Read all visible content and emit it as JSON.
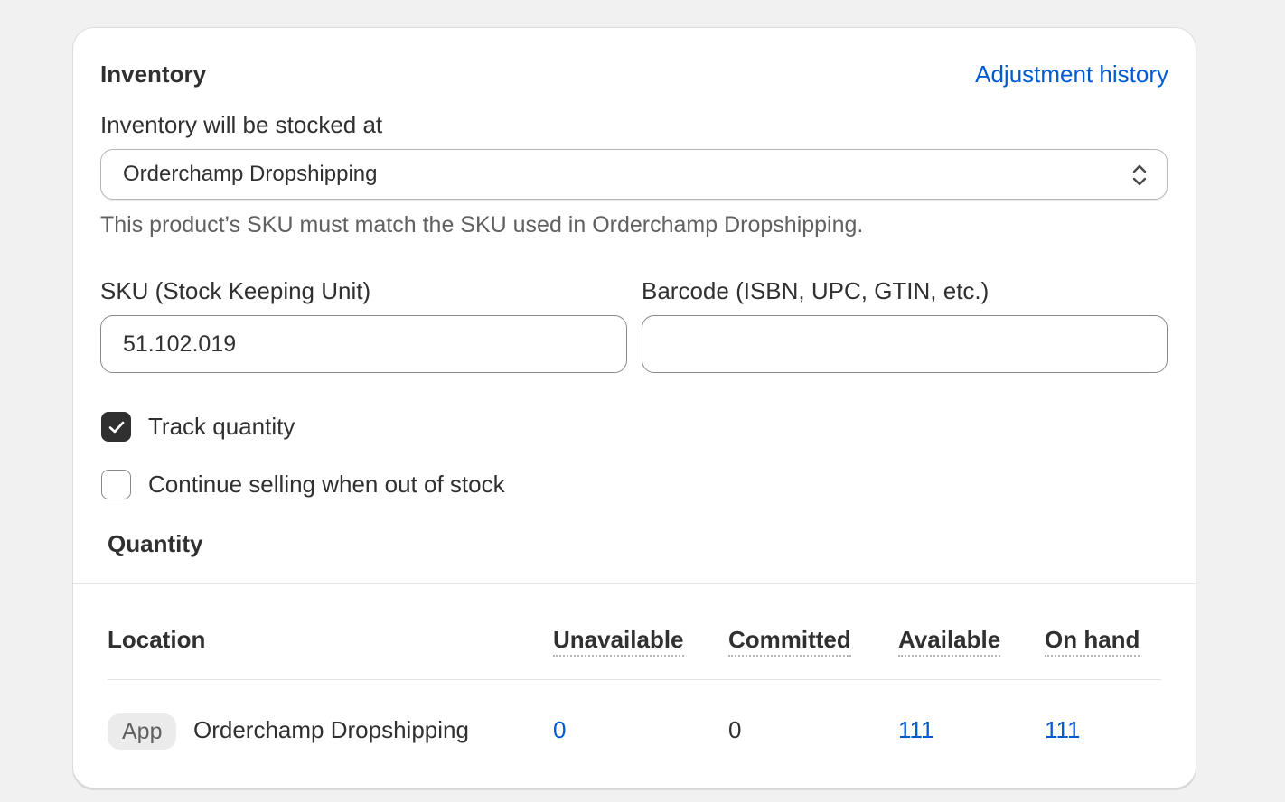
{
  "card": {
    "title": "Inventory",
    "history_link": "Adjustment history"
  },
  "stock_location": {
    "label": "Inventory will be stocked at",
    "selected": "Orderchamp Dropshipping",
    "help_text": "This product’s SKU must match the SKU used in Orderchamp Dropshipping."
  },
  "fields": {
    "sku": {
      "label": "SKU (Stock Keeping Unit)",
      "value": "51.102.019"
    },
    "barcode": {
      "label": "Barcode (ISBN, UPC, GTIN, etc.)",
      "value": ""
    }
  },
  "checkboxes": {
    "track_quantity": {
      "label": "Track quantity",
      "checked": true
    },
    "continue_selling": {
      "label": "Continue selling when out of stock",
      "checked": false
    }
  },
  "quantity": {
    "title": "Quantity",
    "columns": {
      "location": "Location",
      "unavailable": "Unavailable",
      "committed": "Committed",
      "available": "Available",
      "on_hand": "On hand"
    },
    "rows": [
      {
        "badge": "App",
        "location": "Orderchamp Dropshipping",
        "unavailable": "0",
        "committed": "0",
        "available": "111",
        "on_hand": "111"
      }
    ]
  },
  "colors": {
    "link": "#005bd3",
    "text": "#303030",
    "subdued": "#616161",
    "background": "#f1f1f1"
  }
}
